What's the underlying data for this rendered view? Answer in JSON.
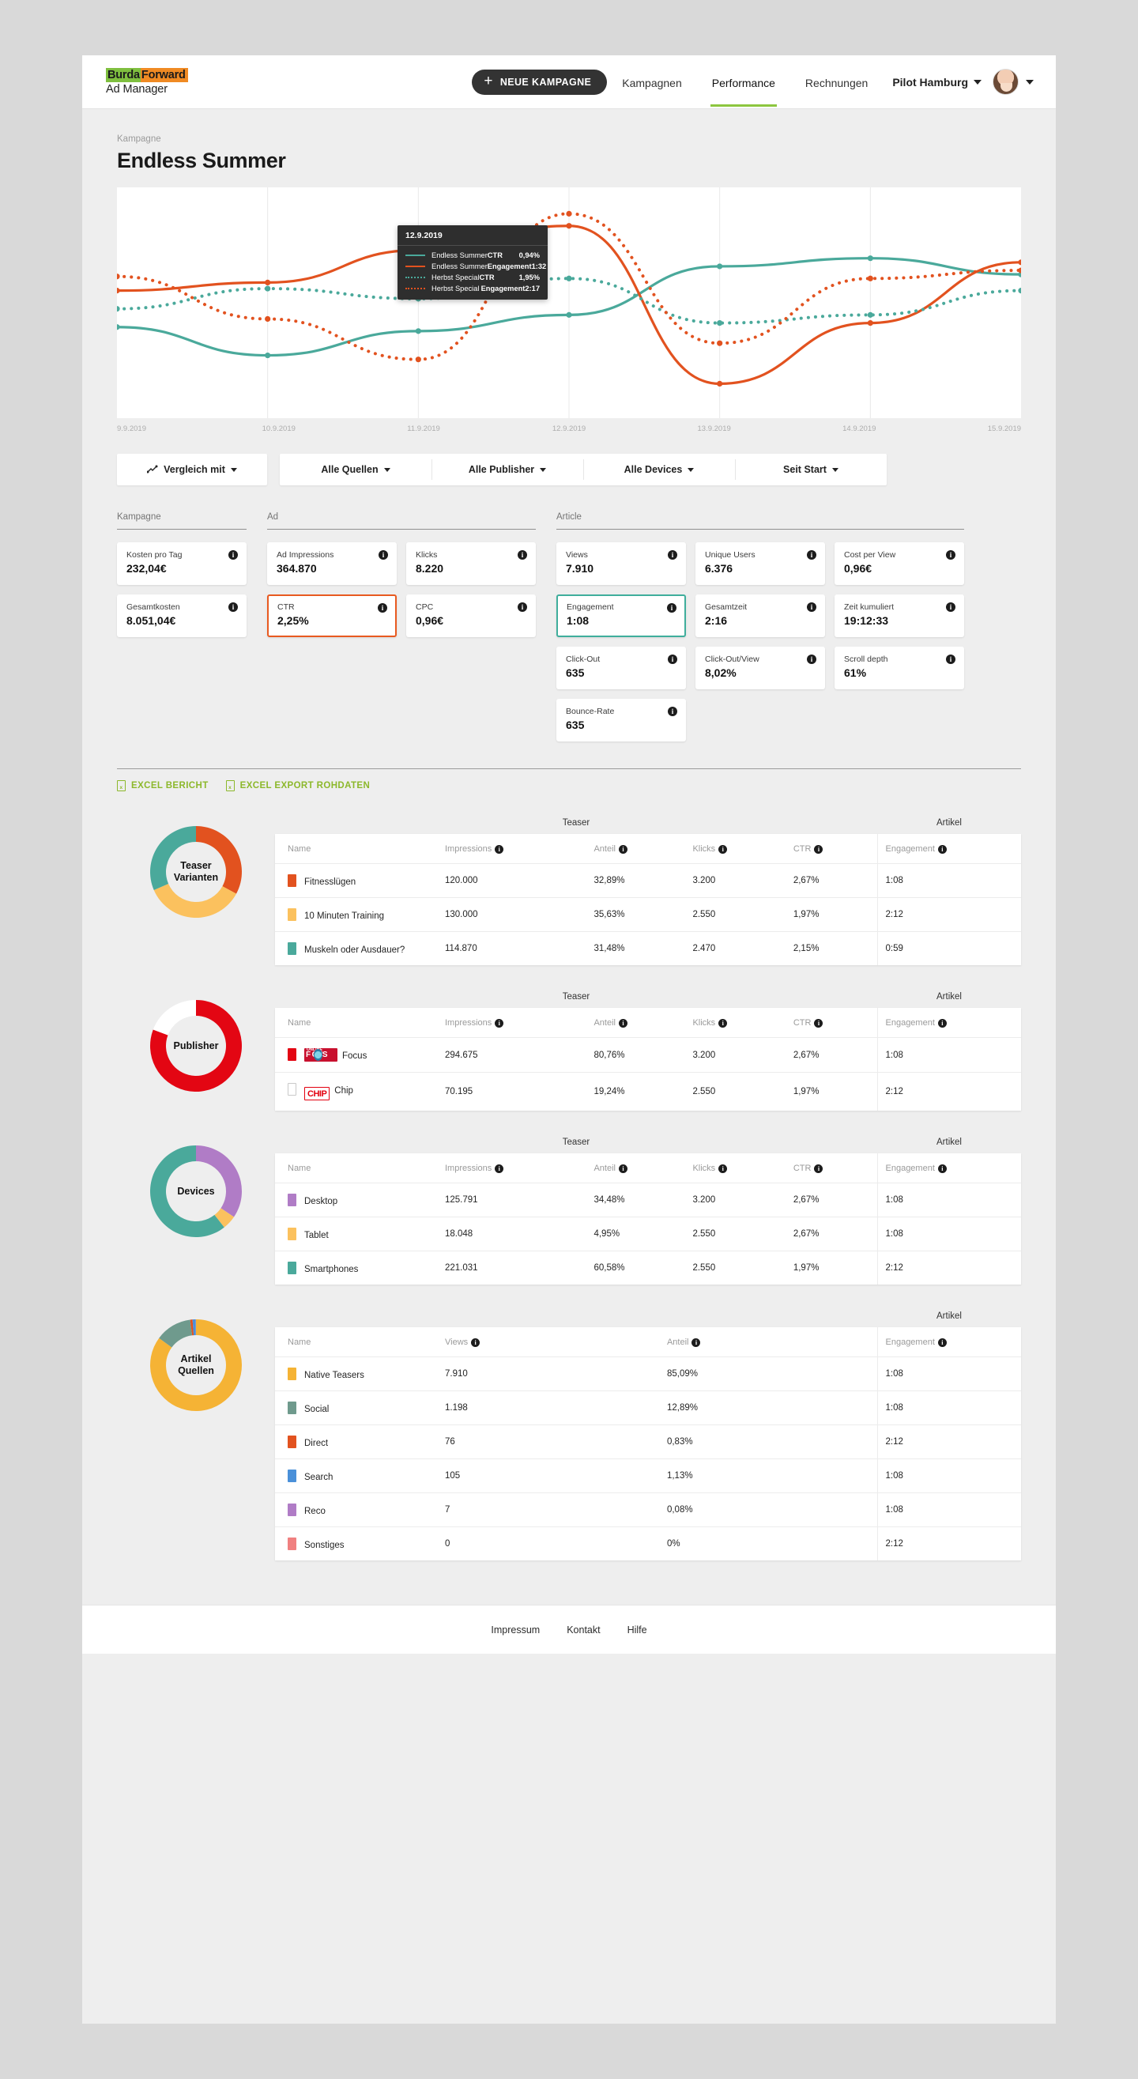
{
  "brand": {
    "logo_part1": "Burda",
    "logo_part2": "Forward",
    "logo_sub": "Ad Manager",
    "green": "#7fbf3f",
    "orange": "#f08a23"
  },
  "topbar": {
    "new_campaign": "NEUE KAMPAGNE",
    "nav": [
      {
        "label": "Kampagnen",
        "active": false
      },
      {
        "label": "Performance",
        "active": true
      },
      {
        "label": "Rechnungen",
        "active": false
      }
    ],
    "account": "Pilot Hamburg"
  },
  "header": {
    "kicker": "Kampagne",
    "title": "Endless Summer"
  },
  "chart_data": {
    "type": "line",
    "title": "Endless Summer",
    "xlabel": "",
    "ylabel": "",
    "grid": true,
    "x": [
      "9.9.2019",
      "10.9.2019",
      "11.9.2019",
      "12.9.2019",
      "13.9.2019",
      "14.9.2019",
      "15.9.2019"
    ],
    "series": [
      {
        "name": "Endless Summer",
        "metric": "CTR",
        "style": "solid",
        "color": "#4aa99b",
        "values": [
          38,
          24,
          36,
          44,
          68,
          72,
          64
        ]
      },
      {
        "name": "Endless Summer",
        "metric": "Engagement",
        "style": "solid",
        "color": "#e2521f",
        "values": [
          56,
          60,
          76,
          88,
          10,
          40,
          70
        ]
      },
      {
        "name": "Herbst Special",
        "metric": "CTR",
        "style": "dotted",
        "color": "#4aa99b",
        "values": [
          47,
          57,
          52,
          62,
          40,
          44,
          56
        ]
      },
      {
        "name": "Herbst Special",
        "metric": "Engagement",
        "style": "dotted",
        "color": "#e2521f",
        "values": [
          63,
          42,
          22,
          94,
          30,
          62,
          66
        ]
      }
    ],
    "tooltip": {
      "date": "12.9.2019",
      "rows": [
        {
          "name": "Endless Summer",
          "metric": "CTR",
          "value": "0,94%",
          "color": "#4aa99b",
          "style": "solid"
        },
        {
          "name": "Endless Summer",
          "metric": "Engagement",
          "value": "1:32",
          "color": "#e2521f",
          "style": "solid"
        },
        {
          "name": "Herbst Special",
          "metric": "CTR",
          "value": "1,95%",
          "color": "#4aa99b",
          "style": "dotted"
        },
        {
          "name": "Herbst Special",
          "metric": "Engagement",
          "value": "2:17",
          "color": "#e2521f",
          "style": "dotted"
        }
      ]
    }
  },
  "filters": {
    "compare": "Vergleich mit",
    "items": [
      "Alle Quellen",
      "Alle Publisher",
      "Alle Devices",
      "Seit Start"
    ]
  },
  "kpi": {
    "columns": [
      {
        "title": "Kampagne",
        "cards": [
          {
            "label": "Kosten pro Tag",
            "value": "232,04€",
            "selected": ""
          },
          {
            "label": "Gesamtkosten",
            "value": "8.051,04€",
            "selected": ""
          }
        ]
      },
      {
        "title": "Ad",
        "cards": [
          {
            "label": "Ad Impressions",
            "value": "364.870",
            "selected": ""
          },
          {
            "label": "Klicks",
            "value": "8.220",
            "selected": ""
          },
          {
            "label": "CTR",
            "value": "2,25%",
            "selected": "orange"
          },
          {
            "label": "CPC",
            "value": "0,96€",
            "selected": ""
          }
        ]
      },
      {
        "title": "Article",
        "cards": [
          {
            "label": "Views",
            "value": "7.910",
            "selected": ""
          },
          {
            "label": "Unique Users",
            "value": "6.376",
            "selected": ""
          },
          {
            "label": "Cost per View",
            "value": "0,96€",
            "selected": ""
          },
          {
            "label": "Engagement",
            "value": "1:08",
            "selected": "teal"
          },
          {
            "label": "Gesamtzeit",
            "value": "2:16",
            "selected": ""
          },
          {
            "label": "Zeit kumuliert",
            "value": "19:12:33",
            "selected": ""
          },
          {
            "label": "Click-Out",
            "value": "635",
            "selected": ""
          },
          {
            "label": "Click-Out/View",
            "value": "8,02%",
            "selected": ""
          },
          {
            "label": "Scroll depth",
            "value": "61%",
            "selected": ""
          },
          {
            "label": "Bounce-Rate",
            "value": "635",
            "selected": ""
          }
        ]
      }
    ]
  },
  "exports": [
    {
      "label": "EXCEL BERICHT"
    },
    {
      "label": "EXCEL EXPORT ROHDATEN"
    }
  ],
  "sections": [
    {
      "donut_label_1": "Teaser",
      "donut_label_2": "Varianten",
      "group_left": "Teaser",
      "group_right": "Artikel",
      "columns": [
        "Name",
        "Impressions",
        "Anteil",
        "Klicks",
        "CTR",
        "Engagement"
      ],
      "donut": [
        {
          "color": "#e2521f",
          "pct": 32.89
        },
        {
          "color": "#fbc15e",
          "pct": 35.63
        },
        {
          "color": "#4aa99b",
          "pct": 31.48
        }
      ],
      "rows": [
        {
          "color": "#e2521f",
          "name": "Fitnesslügen",
          "cells": [
            "120.000",
            "32,89%",
            "3.200",
            "2,67%",
            "1:08"
          ]
        },
        {
          "color": "#fbc15e",
          "name": "10 Minuten Training",
          "cells": [
            "130.000",
            "35,63%",
            "2.550",
            "1,97%",
            "2:12"
          ]
        },
        {
          "color": "#4aa99b",
          "name": "Muskeln oder Ausdauer?",
          "cells": [
            "114.870",
            "31,48%",
            "2.470",
            "2,15%",
            "0:59"
          ]
        }
      ]
    },
    {
      "donut_label_1": "Publisher",
      "donut_label_2": "",
      "group_left": "Teaser",
      "group_right": "Artikel",
      "columns": [
        "Name",
        "Impressions",
        "Anteil",
        "Klicks",
        "CTR",
        "Engagement"
      ],
      "donut": [
        {
          "color": "#e30613",
          "pct": 80.76
        },
        {
          "color": "#ffffff",
          "pct": 19.24
        }
      ],
      "rows": [
        {
          "color": "#e30613",
          "name": "Focus",
          "logo": "focus",
          "cells": [
            "294.675",
            "80,76%",
            "3.200",
            "2,67%",
            "1:08"
          ]
        },
        {
          "color": "#ffffff",
          "name": "Chip",
          "logo": "chip",
          "cells": [
            "70.195",
            "19,24%",
            "2.550",
            "1,97%",
            "2:12"
          ]
        }
      ]
    },
    {
      "donut_label_1": "Devices",
      "donut_label_2": "",
      "group_left": "Teaser",
      "group_right": "Artikel",
      "columns": [
        "Name",
        "Impressions",
        "Anteil",
        "Klicks",
        "CTR",
        "Engagement"
      ],
      "donut": [
        {
          "color": "#b07cc6",
          "pct": 34.48
        },
        {
          "color": "#fbc15e",
          "pct": 4.95
        },
        {
          "color": "#4aa99b",
          "pct": 60.58
        }
      ],
      "rows": [
        {
          "color": "#b07cc6",
          "name": "Desktop",
          "cells": [
            "125.791",
            "34,48%",
            "3.200",
            "2,67%",
            "1:08"
          ]
        },
        {
          "color": "#fbc15e",
          "name": "Tablet",
          "cells": [
            "18.048",
            "4,95%",
            "2.550",
            "2,67%",
            "1:08"
          ]
        },
        {
          "color": "#4aa99b",
          "name": "Smartphones",
          "cells": [
            "221.031",
            "60,58%",
            "2.550",
            "1,97%",
            "2:12"
          ]
        }
      ]
    },
    {
      "donut_label_1": "Artikel",
      "donut_label_2": "Quellen",
      "group_left": "",
      "group_right": "Artikel",
      "columns": [
        "Name",
        "Views",
        "Anteil",
        "Engagement"
      ],
      "donut": [
        {
          "color": "#f5b335",
          "pct": 85.09
        },
        {
          "color": "#6f9a8d",
          "pct": 12.89
        },
        {
          "color": "#e2521f",
          "pct": 0.83
        },
        {
          "color": "#4a90d9",
          "pct": 1.13
        },
        {
          "color": "#b07cc6",
          "pct": 0.08
        },
        {
          "color": "#f08080",
          "pct": 0.0
        }
      ],
      "rows": [
        {
          "color": "#f5b335",
          "name": "Native Teasers",
          "cells": [
            "7.910",
            "85,09%",
            "1:08"
          ]
        },
        {
          "color": "#6f9a8d",
          "name": "Social",
          "cells": [
            "1.198",
            "12,89%",
            "1:08"
          ]
        },
        {
          "color": "#e2521f",
          "name": "Direct",
          "cells": [
            "76",
            "0,83%",
            "2:12"
          ]
        },
        {
          "color": "#4a90d9",
          "name": "Search",
          "cells": [
            "105",
            "1,13%",
            "1:08"
          ]
        },
        {
          "color": "#b07cc6",
          "name": "Reco",
          "cells": [
            "7",
            "0,08%",
            "1:08"
          ]
        },
        {
          "color": "#f08080",
          "name": "Sonstiges",
          "cells": [
            "0",
            "0%",
            "2:12"
          ]
        }
      ]
    }
  ],
  "footer": {
    "links": [
      "Impressum",
      "Kontakt",
      "Hilfe"
    ]
  }
}
